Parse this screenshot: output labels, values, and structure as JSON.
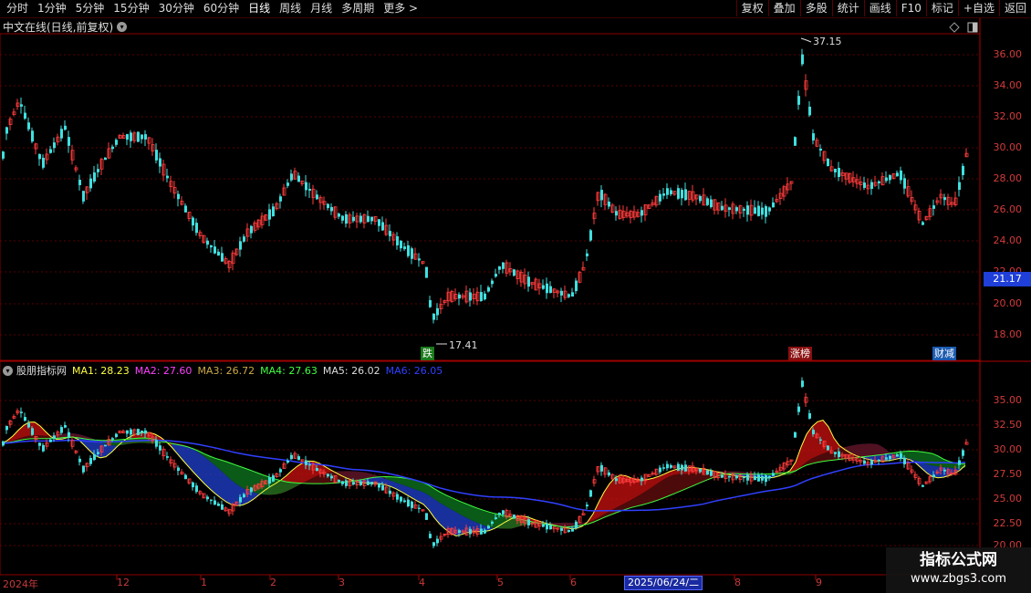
{
  "toolbar": {
    "periods": [
      "分时",
      "1分钟",
      "5分钟",
      "15分钟",
      "30分钟",
      "60分钟",
      "日线",
      "周线",
      "月线",
      "多周期",
      "更多 >"
    ],
    "active": "日线",
    "right_buttons": [
      "复权",
      "叠加",
      "多股",
      "统计",
      "画线",
      "F10",
      "标记",
      "+自选",
      "返回"
    ]
  },
  "main_panel": {
    "title": "中文在线(日线,前复权)",
    "y_labels": [
      "36.00",
      "34.00",
      "32.00",
      "30.00",
      "28.00",
      "26.00",
      "24.00",
      "22.00",
      "20.00",
      "18.00"
    ],
    "current_price": "21.17",
    "high_label": "37.15",
    "low_label": "17.41",
    "markers": [
      {
        "text": "跌",
        "color": "#22aa22"
      },
      {
        "text": "涨榜",
        "color": "#b01818"
      },
      {
        "text": "财减",
        "color": "#2a7ad8"
      }
    ]
  },
  "indicator_panel": {
    "name": "股朋指标网",
    "ma": [
      {
        "label": "MA1: 28.23",
        "color": "#ffff40"
      },
      {
        "label": "MA2: 27.60",
        "color": "#ff40ff"
      },
      {
        "label": "MA3: 26.72",
        "color": "#ccaa44"
      },
      {
        "label": "MA4: 27.63",
        "color": "#40ff40"
      },
      {
        "label": "MA5: 26.02",
        "color": "#dddddd"
      },
      {
        "label": "MA6: 26.05",
        "color": "#3040ff"
      }
    ],
    "y_labels": [
      "35.00",
      "32.50",
      "30.00",
      "27.50",
      "25.00",
      "22.50",
      "20.00"
    ]
  },
  "x_axis": {
    "labels": [
      "2024年",
      "12",
      "1",
      "2",
      "3",
      "4",
      "5",
      "6",
      "8",
      "9"
    ],
    "cursor_date": "2025/06/24/二"
  },
  "watermark": {
    "line1": "指标公式网",
    "line2": "www.zbgs3.com"
  },
  "colors": {
    "up": "#ff3c3c",
    "down": "#40e0e0",
    "grid": "#6a0000",
    "axis": "#b00000"
  }
}
